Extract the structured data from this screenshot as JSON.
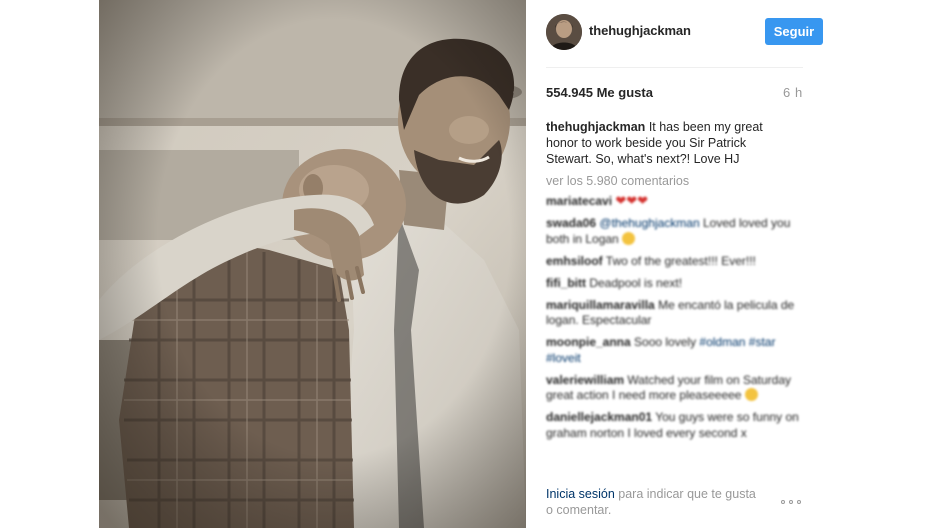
{
  "post": {
    "username": "thehughjackman",
    "follow_label": "Seguir",
    "likes": "554.945 Me gusta",
    "time": "6 h",
    "caption_user": "thehughjackman",
    "caption_text": "It has been my great honor to work beside you Sir Patrick Stewart. So, what's next?! Love HJ",
    "view_comments": "ver los 5.980 comentarios"
  },
  "comments": [
    {
      "user": "mariatecavi",
      "text": "",
      "extra": "hearts"
    },
    {
      "user": "swada06",
      "mention": "@thehughjackman",
      "text": "Loved loved you both in Logan",
      "extra": "emoji"
    },
    {
      "user": "emhsiloof",
      "text": "Two of the greatest!!! Ever!!!"
    },
    {
      "user": "fifi_bitt",
      "text": "Deadpool is next!"
    },
    {
      "user": "mariquillamaravilla",
      "text": "Me encantó la pelicula de logan. Espectacular"
    },
    {
      "user": "moonpie_anna",
      "text": "Sooo lovely",
      "tags": "#oldman #star #loveit"
    },
    {
      "user": "valeriewilliam",
      "text": "Watched your film on Saturday great action I need more pleaseeeee",
      "extra": "emoji"
    },
    {
      "user": "daniellejackman01",
      "text": "You guys were so funny on graham norton I loved every second x"
    }
  ],
  "footer": {
    "login_label": "Inicia sesión",
    "rest_text": "para indicar que te gusta o comentar."
  },
  "icons": {
    "more": "more-options-icon"
  },
  "colors": {
    "follow_button": "#3897f0",
    "link": "#003569",
    "muted": "#999999"
  }
}
